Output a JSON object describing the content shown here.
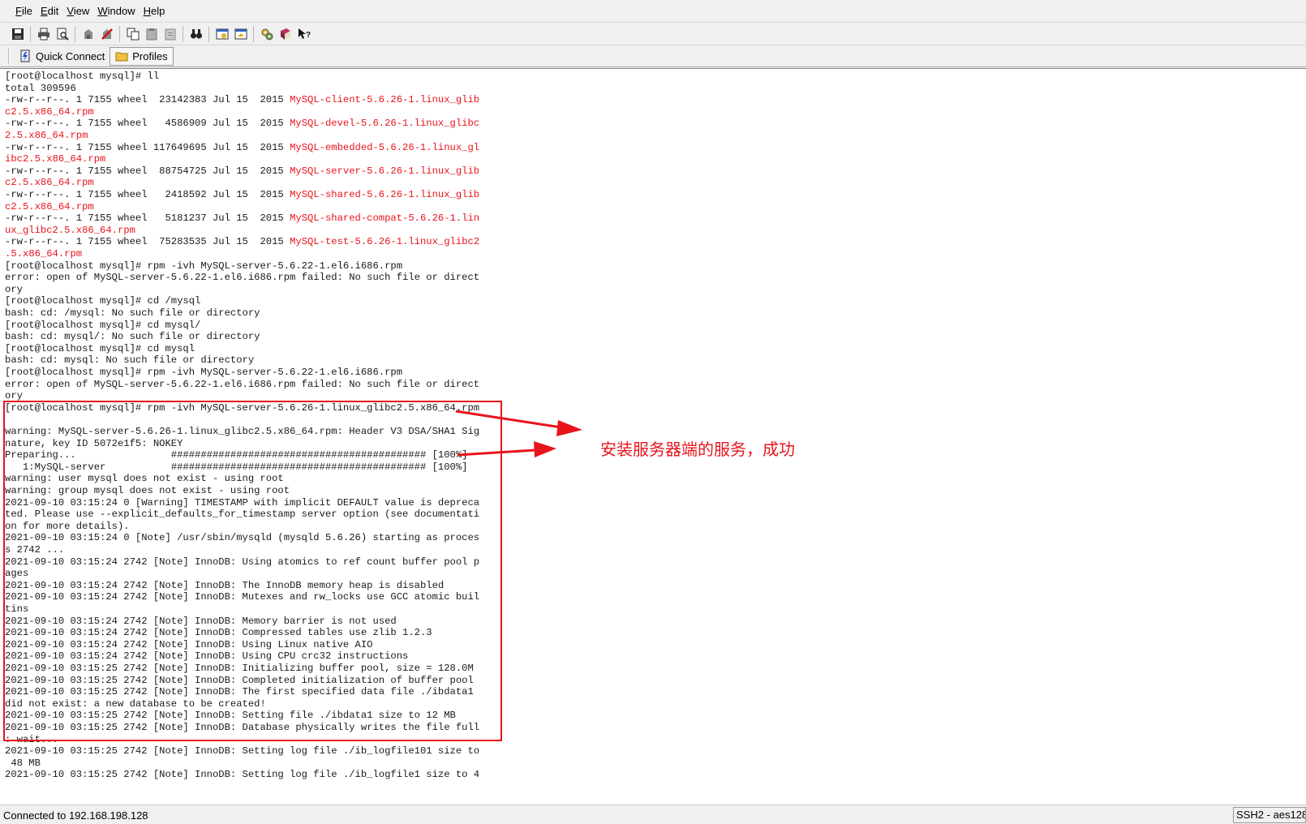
{
  "menu": [
    "File",
    "Edit",
    "View",
    "Window",
    "Help"
  ],
  "toolbar": {
    "icons": [
      "save-icon",
      "print-icon",
      "print-preview-icon",
      "connect-icon",
      "disconnect-icon",
      "copy-icon",
      "paste-icon",
      "clipboard-icon",
      "find-icon",
      "session-options-icon",
      "file-transfer-icon",
      "settings-icon",
      "help-book-icon",
      "context-help-icon"
    ]
  },
  "connectbar": {
    "quick_connect": "Quick Connect",
    "profiles": "Profiles"
  },
  "terminal": {
    "lines": [
      {
        "text": "[root@localhost mysql]# ll"
      },
      {
        "text": "total 309596"
      },
      {
        "text": "-rw-r--r--. 1 7155 wheel  23142383 Jul 15  2015 ",
        "red": "MySQL-client-5.6.26-1.linux_glib"
      },
      {
        "text": "",
        "red": "c2.5.x86_64.rpm"
      },
      {
        "text": "-rw-r--r--. 1 7155 wheel   4586909 Jul 15  2015 ",
        "red": "MySQL-devel-5.6.26-1.linux_glibc"
      },
      {
        "text": "",
        "red": "2.5.x86_64.rpm"
      },
      {
        "text": "-rw-r--r--. 1 7155 wheel 117649695 Jul 15  2015 ",
        "red": "MySQL-embedded-5.6.26-1.linux_gl"
      },
      {
        "text": "",
        "red": "ibc2.5.x86_64.rpm"
      },
      {
        "text": "-rw-r--r--. 1 7155 wheel  88754725 Jul 15  2015 ",
        "red": "MySQL-server-5.6.26-1.linux_glib"
      },
      {
        "text": "",
        "red": "c2.5.x86_64.rpm"
      },
      {
        "text": "-rw-r--r--. 1 7155 wheel   2418592 Jul 15  2015 ",
        "red": "MySQL-shared-5.6.26-1.linux_glib"
      },
      {
        "text": "",
        "red": "c2.5.x86_64.rpm"
      },
      {
        "text": "-rw-r--r--. 1 7155 wheel   5181237 Jul 15  2015 ",
        "red": "MySQL-shared-compat-5.6.26-1.lin"
      },
      {
        "text": "",
        "red": "ux_glibc2.5.x86_64.rpm"
      },
      {
        "text": "-rw-r--r--. 1 7155 wheel  75283535 Jul 15  2015 ",
        "red": "MySQL-test-5.6.26-1.linux_glibc2"
      },
      {
        "text": "",
        "red": ".5.x86_64.rpm"
      },
      {
        "text": "[root@localhost mysql]# rpm -ivh MySQL-server-5.6.22-1.el6.i686.rpm"
      },
      {
        "text": "error: open of MySQL-server-5.6.22-1.el6.i686.rpm failed: No such file or direct"
      },
      {
        "text": "ory"
      },
      {
        "text": "[root@localhost mysql]# cd /mysql"
      },
      {
        "text": "bash: cd: /mysql: No such file or directory"
      },
      {
        "text": "[root@localhost mysql]# cd mysql/"
      },
      {
        "text": "bash: cd: mysql/: No such file or directory"
      },
      {
        "text": "[root@localhost mysql]# cd mysql"
      },
      {
        "text": "bash: cd: mysql: No such file or directory"
      },
      {
        "text": "[root@localhost mysql]# rpm -ivh MySQL-server-5.6.22-1.el6.i686.rpm"
      },
      {
        "text": "error: open of MySQL-server-5.6.22-1.el6.i686.rpm failed: No such file or direct"
      },
      {
        "text": "ory"
      },
      {
        "text": "[root@localhost mysql]# rpm -ivh MySQL-server-5.6.26-1.linux_glibc2.5.x86_64.rpm"
      },
      {
        "text": ""
      },
      {
        "text": "warning: MySQL-server-5.6.26-1.linux_glibc2.5.x86_64.rpm: Header V3 DSA/SHA1 Sig"
      },
      {
        "text": "nature, key ID 5072e1f5: NOKEY"
      },
      {
        "text": "Preparing...                ########################################### [100%]"
      },
      {
        "text": "   1:MySQL-server           ########################################### [100%]"
      },
      {
        "text": "warning: user mysql does not exist - using root"
      },
      {
        "text": "warning: group mysql does not exist - using root"
      },
      {
        "text": "2021-09-10 03:15:24 0 [Warning] TIMESTAMP with implicit DEFAULT value is depreca"
      },
      {
        "text": "ted. Please use --explicit_defaults_for_timestamp server option (see documentati"
      },
      {
        "text": "on for more details)."
      },
      {
        "text": "2021-09-10 03:15:24 0 [Note] /usr/sbin/mysqld (mysqld 5.6.26) starting as proces"
      },
      {
        "text": "s 2742 ..."
      },
      {
        "text": "2021-09-10 03:15:24 2742 [Note] InnoDB: Using atomics to ref count buffer pool p"
      },
      {
        "text": "ages"
      },
      {
        "text": "2021-09-10 03:15:24 2742 [Note] InnoDB: The InnoDB memory heap is disabled"
      },
      {
        "text": "2021-09-10 03:15:24 2742 [Note] InnoDB: Mutexes and rw_locks use GCC atomic buil"
      },
      {
        "text": "tins"
      },
      {
        "text": "2021-09-10 03:15:24 2742 [Note] InnoDB: Memory barrier is not used"
      },
      {
        "text": "2021-09-10 03:15:24 2742 [Note] InnoDB: Compressed tables use zlib 1.2.3"
      },
      {
        "text": "2021-09-10 03:15:24 2742 [Note] InnoDB: Using Linux native AIO"
      },
      {
        "text": "2021-09-10 03:15:24 2742 [Note] InnoDB: Using CPU crc32 instructions"
      },
      {
        "text": "2021-09-10 03:15:25 2742 [Note] InnoDB: Initializing buffer pool, size = 128.0M"
      },
      {
        "text": "2021-09-10 03:15:25 2742 [Note] InnoDB: Completed initialization of buffer pool"
      },
      {
        "text": "2021-09-10 03:15:25 2742 [Note] InnoDB: The first specified data file ./ibdata1"
      },
      {
        "text": "did not exist: a new database to be created!"
      },
      {
        "text": "2021-09-10 03:15:25 2742 [Note] InnoDB: Setting file ./ibdata1 size to 12 MB"
      },
      {
        "text": "2021-09-10 03:15:25 2742 [Note] InnoDB: Database physically writes the file full"
      },
      {
        "text": ": wait..."
      },
      {
        "text": "2021-09-10 03:15:25 2742 [Note] InnoDB: Setting log file ./ib_logfile101 size to"
      },
      {
        "text": " 48 MB"
      },
      {
        "text": "2021-09-10 03:15:25 2742 [Note] InnoDB: Setting log file ./ib_logfile1 size to 4"
      }
    ]
  },
  "annotation": {
    "caption": "安装服务器端的服务，成功",
    "color": "#e8141c"
  },
  "status": {
    "connection": "Connected to 192.168.198.128",
    "protocol": "SSH2 - aes128"
  }
}
